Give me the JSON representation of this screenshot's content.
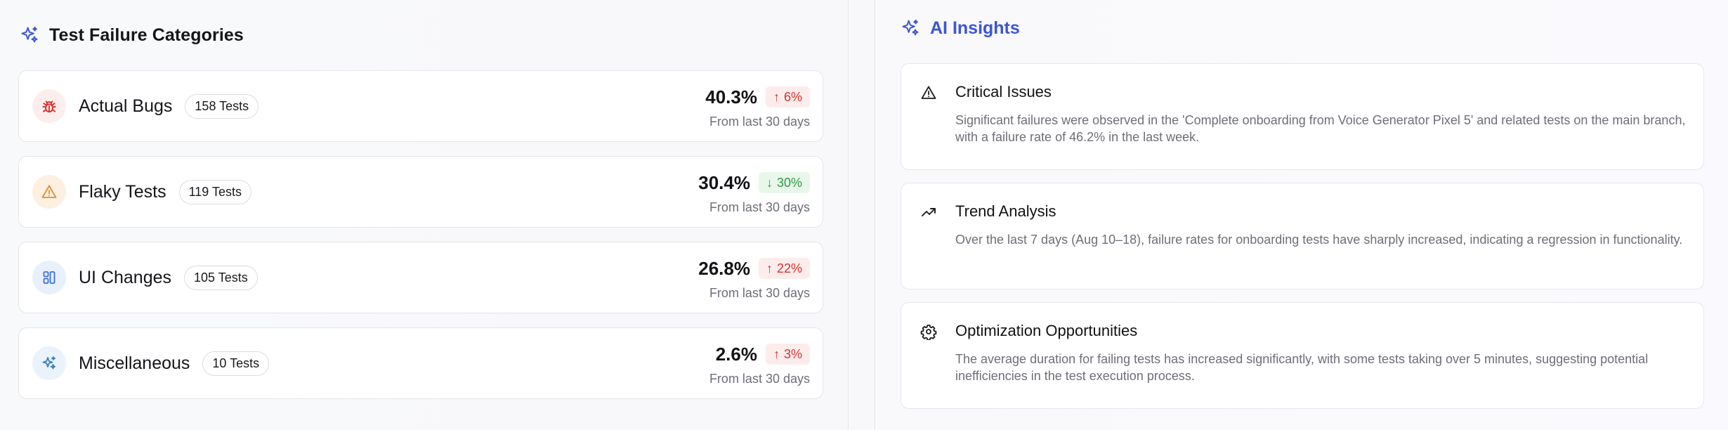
{
  "left": {
    "title": "Test Failure Categories",
    "categories": [
      {
        "name": "Actual Bugs",
        "count": "158 Tests",
        "percent": "40.3%",
        "trend": "6%",
        "direction": "up",
        "sub": "From last 30 days",
        "icon": "bug-icon",
        "icon_bg": "#fdeeee",
        "icon_color": "#d8322f"
      },
      {
        "name": "Flaky Tests",
        "count": "119 Tests",
        "percent": "30.4%",
        "trend": "30%",
        "direction": "down",
        "sub": "From last 30 days",
        "icon": "warning-icon",
        "icon_bg": "#fdf0e1",
        "icon_color": "#e0902f"
      },
      {
        "name": "UI Changes",
        "count": "105 Tests",
        "percent": "26.8%",
        "trend": "22%",
        "direction": "up",
        "sub": "From last 30 days",
        "icon": "layout-icon",
        "icon_bg": "#e8f0fc",
        "icon_color": "#3b6fd8"
      },
      {
        "name": "Miscellaneous",
        "count": "10 Tests",
        "percent": "2.6%",
        "trend": "3%",
        "direction": "up",
        "sub": "From last 30 days",
        "icon": "sparkles-icon",
        "icon_bg": "#eaf3fb",
        "icon_color": "#3b7fc0"
      }
    ]
  },
  "right": {
    "title": "AI Insights",
    "insights": [
      {
        "title": "Critical Issues",
        "icon": "alert-triangle-icon",
        "body": "Significant failures were observed in the 'Complete onboarding from Voice Generator Pixel 5' and related tests on the main branch, with a failure rate of 46.2% in the last week."
      },
      {
        "title": "Trend Analysis",
        "icon": "trending-up-icon",
        "body": "Over the last 7 days (Aug 10–18), failure rates for onboarding tests have sharply increased, indicating a regression in functionality."
      },
      {
        "title": "Optimization Opportunities",
        "icon": "gear-icon",
        "body": "The average duration for failing tests has increased significantly, with some tests taking over 5 minutes, suggesting potential inefficiencies in the test execution process."
      }
    ]
  },
  "colors": {
    "accent": "#3c55d6",
    "trend_up_text": "#d8322f",
    "trend_up_bg": "#fdecec",
    "trend_down_text": "#2d9b3f",
    "trend_down_bg": "#e8f7ea"
  }
}
